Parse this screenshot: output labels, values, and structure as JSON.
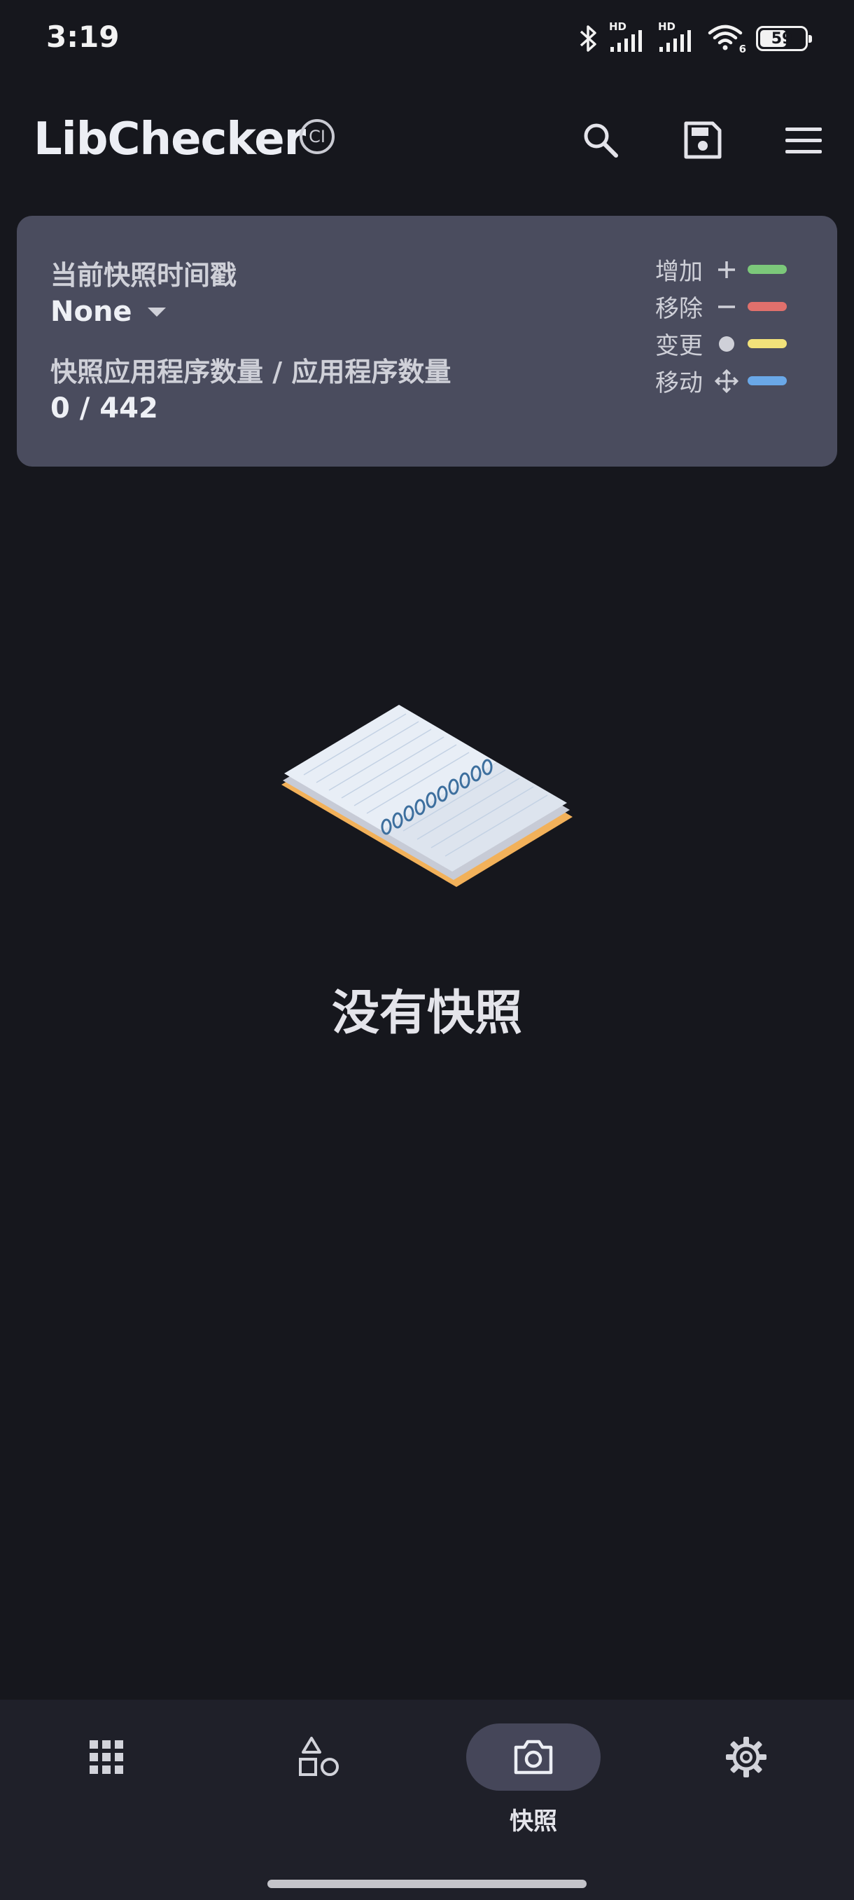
{
  "status_bar": {
    "time": "3:19",
    "battery_level": 59,
    "battery_label": "59",
    "network_label": "HD",
    "wifi_label": "6"
  },
  "app_bar": {
    "title": "LibChecker",
    "badge": "CI",
    "actions": [
      "search-icon",
      "save-icon",
      "menu-icon"
    ]
  },
  "snapshot_card": {
    "timestamp_label": "当前快照时间戳",
    "timestamp_value": "None",
    "count_label": "快照应用程序数量 / 应用程序数量",
    "count_value": "0 / 442",
    "legend": [
      {
        "label": "增加",
        "symbol": "plus-icon",
        "color": "#7cc87a"
      },
      {
        "label": "移除",
        "symbol": "minus-icon",
        "color": "#e0706c"
      },
      {
        "label": "变更",
        "symbol": "dot-icon",
        "color": "#f2e27a"
      },
      {
        "label": "移动",
        "symbol": "move-icon",
        "color": "#6aa8e8"
      }
    ]
  },
  "empty_state": {
    "message": "没有快照"
  },
  "bottom_nav": {
    "items": [
      {
        "icon": "apps-grid-icon",
        "label": ""
      },
      {
        "icon": "shapes-icon",
        "label": ""
      },
      {
        "icon": "camera-icon",
        "label": "快照",
        "active": true
      },
      {
        "icon": "settings-icon",
        "label": ""
      }
    ]
  },
  "colors": {
    "background": "#16171d",
    "card": "#4a4c5e",
    "nav_background": "#1f2029",
    "nav_active_pill": "#454659"
  }
}
